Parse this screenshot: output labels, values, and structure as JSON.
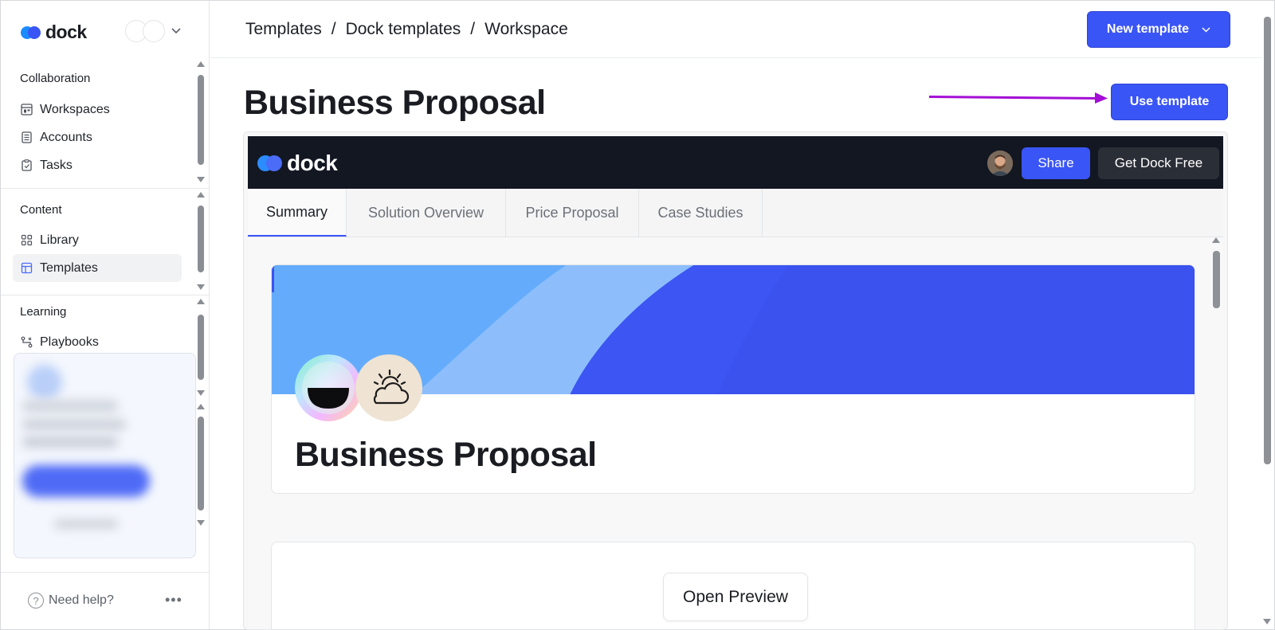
{
  "brand": {
    "name": "dock"
  },
  "sidebar": {
    "sections": [
      {
        "title": "Collaboration",
        "items": [
          {
            "label": "Workspaces",
            "icon": "workspaces-icon"
          },
          {
            "label": "Accounts",
            "icon": "accounts-icon"
          },
          {
            "label": "Tasks",
            "icon": "tasks-icon"
          }
        ]
      },
      {
        "title": "Content",
        "items": [
          {
            "label": "Library",
            "icon": "library-icon"
          },
          {
            "label": "Templates",
            "icon": "templates-icon",
            "active": true
          }
        ]
      },
      {
        "title": "Learning",
        "items": [
          {
            "label": "Playbooks",
            "icon": "playbooks-icon"
          }
        ]
      }
    ],
    "help_label": "Need help?"
  },
  "breadcrumb": [
    "Templates",
    "Dock templates",
    "Workspace"
  ],
  "header": {
    "new_template_label": "New template"
  },
  "page": {
    "title": "Business Proposal",
    "use_template_label": "Use template"
  },
  "preview": {
    "brand": "dock",
    "share_label": "Share",
    "get_dock_label": "Get Dock Free",
    "tabs": [
      "Summary",
      "Solution Overview",
      "Price Proposal",
      "Case Studies"
    ],
    "active_tab": "Summary",
    "hero_title": "Business Proposal",
    "open_preview_label": "Open Preview"
  },
  "colors": {
    "accent": "#3a55f5",
    "preview_header": "#131722",
    "annotation_arrow": "#a40ed6"
  }
}
